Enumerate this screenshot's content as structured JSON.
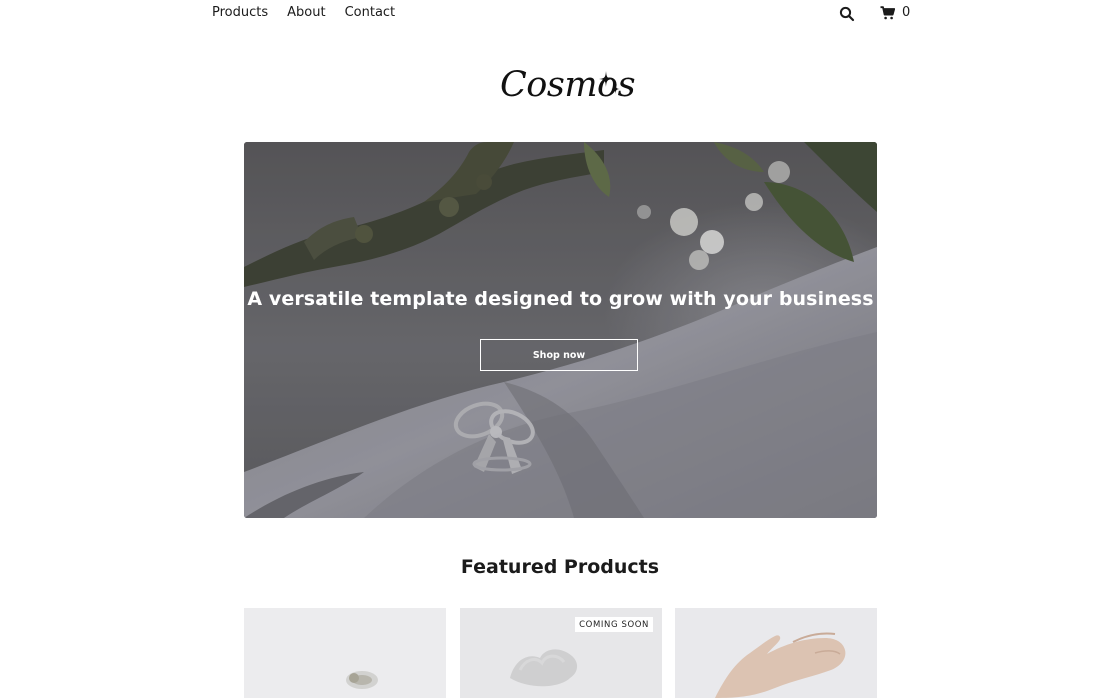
{
  "nav": {
    "items": [
      "Products",
      "About",
      "Contact"
    ],
    "cart_count": "0",
    "icons": {
      "search": "search-icon",
      "cart": "cart-icon"
    }
  },
  "brand": {
    "logo_text": "Cosmos"
  },
  "hero": {
    "headline": "A versatile template designed to grow with your business",
    "cta_label": "Shop now"
  },
  "featured": {
    "title": "Featured Products",
    "products": [
      {
        "badge": ""
      },
      {
        "badge": "COMING SOON"
      },
      {
        "badge": ""
      }
    ]
  }
}
